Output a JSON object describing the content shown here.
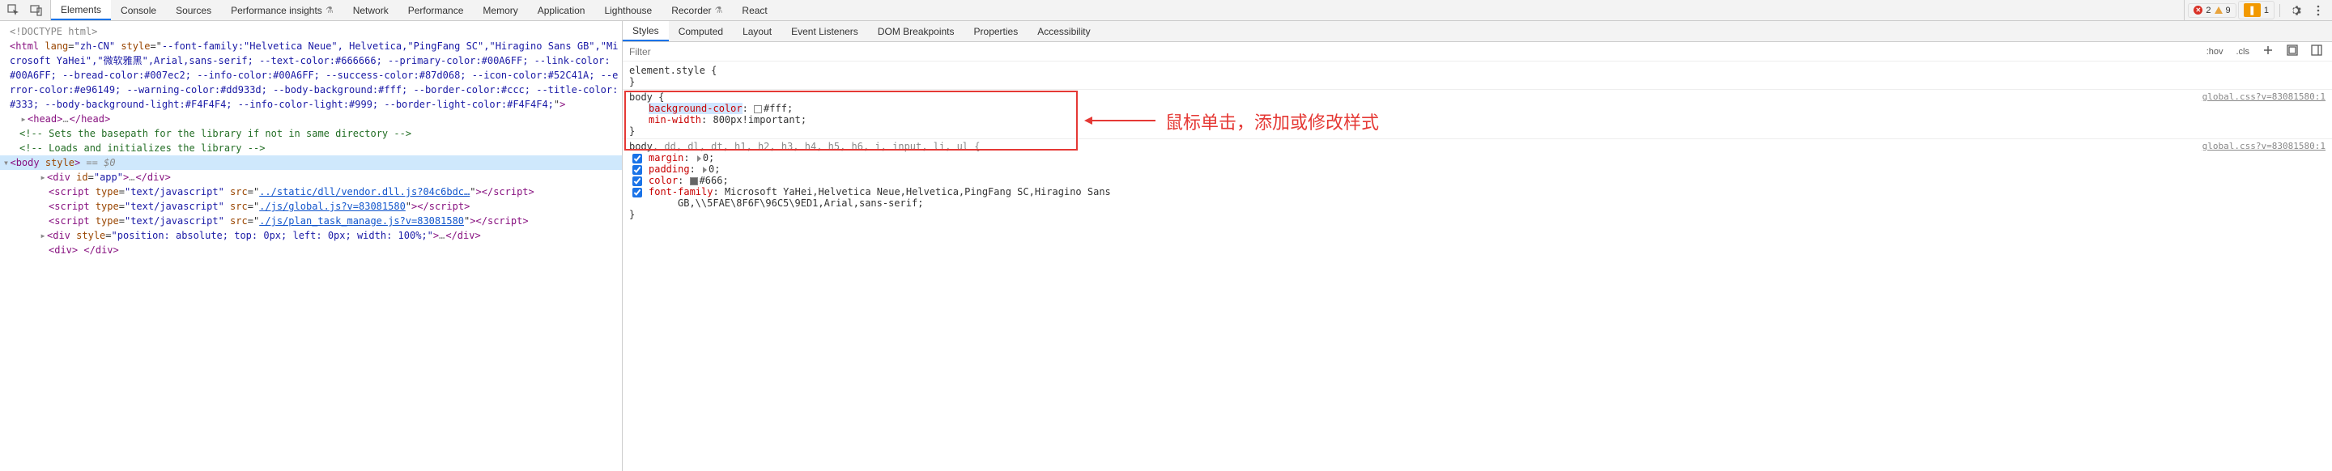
{
  "toolbar": {
    "tabs": [
      "Elements",
      "Console",
      "Sources",
      "Performance insights",
      "Network",
      "Performance",
      "Memory",
      "Application",
      "Lighthouse",
      "Recorder",
      "React"
    ],
    "active_tab": 0,
    "errors": "2",
    "warnings": "9",
    "issues": "1"
  },
  "elements": {
    "doctype": "<!DOCTYPE html>",
    "html_open_1": "<html lang=\"zh-CN\" style=\"--font-family:\"Helvetica Neue\", Helvetica,\"PingFang SC\",\"Hiragino Sans GB\",\"Mi",
    "html_open_2": "crosoft YaHei\",\"微软雅黑\",Arial,sans-serif; --text-color:#666666; --primary-color:#00A6FF; --link-color:",
    "html_open_3": "#00A6FF; --bread-color:#007ec2; --info-color:#00A6FF; --success-color:#87d068; --icon-color:#52C41A; --e",
    "html_open_4": "rror-color:#e96149; --warning-color:#dd933d; --body-background:#fff; --border-color:#ccc; --title-color:",
    "html_open_5": "#333; --body-background-light:#F4F4F4; --info-color-light:#999; --border-light-color:#F4F4F4;\">",
    "head": "<head>…</head>",
    "comment1": "<!-- Sets the basepath for the library if not in same directory -->",
    "comment2": "<!-- Loads and initializes the library -->",
    "body_open": "<body style>",
    "body_eq": " == $0",
    "div_app": "<div id=\"app\">…</div>",
    "script1_pre": "<script type=\"text/javascript\" src=\"",
    "script1_link": "../static/dll/vendor.dll.js?04c6bdc…",
    "script1_post": "\"></script>",
    "script2_pre": "<script type=\"text/javascript\" src=\"",
    "script2_link": "./js/global.js?v=83081580",
    "script2_post": "\"></script>",
    "script3_pre": "<script type=\"text/javascript\" src=\"",
    "script3_link": "./js/plan_task_manage.js?v=83081580",
    "script3_post": "\"></script>",
    "div_abs": "<div style=\"position: absolute; top: 0px; left: 0px; width: 100%;\">…</div>",
    "div_last": "<div> </div>"
  },
  "styles_tabs": {
    "items": [
      "Styles",
      "Computed",
      "Layout",
      "Event Listeners",
      "DOM Breakpoints",
      "Properties",
      "Accessibility"
    ],
    "active": 0
  },
  "filter": {
    "placeholder": "Filter",
    "hov": ":hov",
    "cls": ".cls"
  },
  "rules": {
    "element_style": {
      "selector": "element.style {",
      "close": "}"
    },
    "body_rule": {
      "selector": "body {",
      "source": "global.css?v=83081580:1",
      "p1_name": "background-color",
      "p1_val": "#fff",
      "p2_name": "min-width",
      "p2_val": "800px!important",
      "close": "}"
    },
    "reset_rule": {
      "selector_body": "body",
      "selector_rest": ", dd, dl, dt, h1, h2, h3, h4, h5, h6, i, input, li, ul {",
      "source": "global.css?v=83081580:1",
      "p1_name": "margin",
      "p1_val": "0",
      "p2_name": "padding",
      "p2_val": "0",
      "p3_name": "color",
      "p3_val": "#666",
      "p4_name": "font-family",
      "p4_val_1": "Microsoft YaHei,Helvetica Neue,Helvetica,PingFang SC,Hiragino Sans",
      "p4_val_2": "GB,\\\\5FAE\\8F6F\\96C5\\9ED1,Arial,sans-serif",
      "close": "}"
    }
  },
  "annotation": {
    "label": "鼠标单击，添加或修改样式"
  }
}
